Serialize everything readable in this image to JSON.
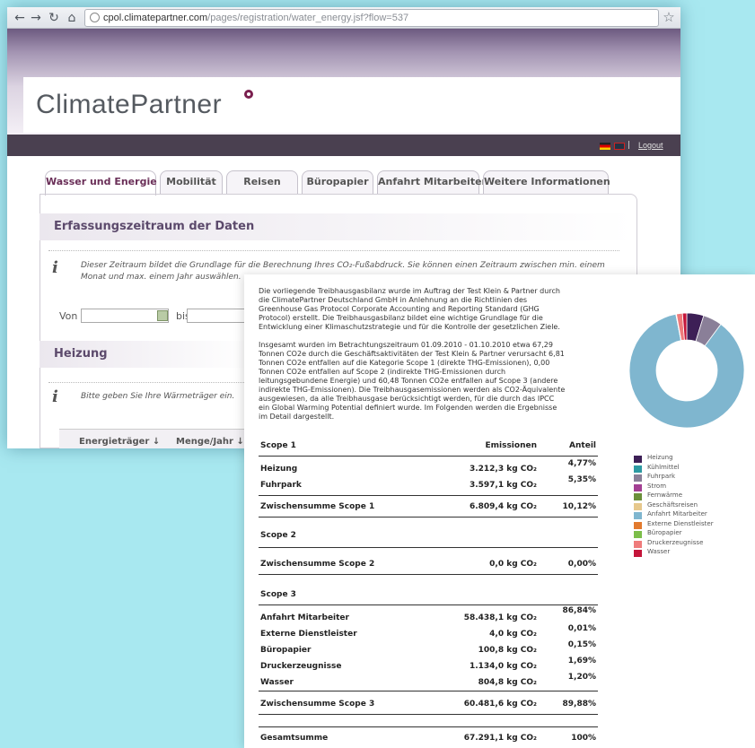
{
  "browser": {
    "url_host": "cpol.climatepartner.com",
    "url_path": "/pages/registration/water_energy.jsf?flow=537",
    "back_icon": "arrow-left-icon",
    "forward_icon": "arrow-right-icon",
    "reload_icon": "reload-icon",
    "home_icon": "home-icon",
    "bookmark_icon": "star-icon"
  },
  "header": {
    "logo_text": "ClimatePartner",
    "logout_label": "Logout",
    "separator": "|",
    "brand_color": "#6b2d5c"
  },
  "tabs": [
    {
      "label": "Wasser und Energie",
      "active": true
    },
    {
      "label": "Mobilität",
      "active": false
    },
    {
      "label": "Reisen",
      "active": false
    },
    {
      "label": "Büropapier",
      "active": false
    },
    {
      "label": "Anfahrt Mitarbeiter",
      "active": false
    },
    {
      "label": "Weitere Informationen",
      "active": false
    }
  ],
  "period": {
    "title": "Erfassungszeitraum der Daten",
    "info_line1": "Dieser Zeitraum bildet die Grundlage für die Berechnung Ihres CO₂-Fußabdruck. Sie können einen Zeitraum zwischen min. einem",
    "info_line2": "Monat und max. einem Jahr auswählen.",
    "from_label": "Von",
    "to_label": "bis"
  },
  "heating": {
    "title": "Heizung",
    "info": "Bitte geben Sie Ihre Wärmeträger ein.",
    "col_energy": "Energieträger ↓",
    "col_amount": "Menge/Jahr ↓"
  },
  "report": {
    "para1": [
      "Die vorliegende Treibhausgasbilanz wurde im Auftrag der Test Klein & Partner durch",
      "die ClimatePartner Deutschland GmbH in Anlehnung an die Richtlinien des",
      "Greenhouse Gas Protocol Corporate Accounting and Reporting Standard (GHG",
      "Protocol) erstellt. Die Treibhausgasbilanz bildet eine wichtige Grundlage für die",
      "Entwicklung einer Klimaschutzstrategie und für die Kontrolle der gesetzlichen Ziele."
    ],
    "para2": [
      "Insgesamt wurden  im Betrachtungszeitraum  01.09.2010 - 01.10.2010 etwa 67,29",
      "Tonnen CO2e durch die Geschäftsaktivitäten der Test Klein & Partner verursacht 6,81",
      "Tonnen CO2e entfallen auf die Kategorie Scope 1 (direkte THG-Emissionen), 0,00",
      "Tonnen CO2e entfallen auf Scope 2 (indirekte THG-Emissionen durch",
      "leitungsgebundene Energie) und 60,48 Tonnen CO2e entfallen auf Scope 3 (andere",
      "indirekte THG-Emissionen). Die Treibhausgasemissionen werden als CO2-Äquivalente",
      "ausgewiesen, da alle Treibhausgase berücksichtigt werden, für die durch das IPCC",
      "ein Global Warming Potential definiert wurde. Im Folgenden werden die Ergebnisse",
      "im Detail dargestellt."
    ],
    "col_emissions": "Emissionen",
    "col_share": "Anteil",
    "scope1_title": "Scope 1",
    "scope1_rows": [
      {
        "label": "Heizung",
        "value": "3.212,3 kg CO₂",
        "share": "4,77%"
      },
      {
        "label": "Fuhrpark",
        "value": "3.597,1 kg CO₂",
        "share": "5,35%"
      }
    ],
    "scope1_subtotal": {
      "label": "Zwischensumme Scope 1",
      "value": "6.809,4 kg CO₂",
      "share": "10,12%"
    },
    "scope2_title": "Scope 2",
    "scope2_subtotal": {
      "label": "Zwischensumme Scope 2",
      "value": "0,0 kg CO₂",
      "share": "0,00%"
    },
    "scope3_title": "Scope 3",
    "scope3_rows": [
      {
        "label": "Anfahrt Mitarbeiter",
        "value": "58.438,1 kg CO₂",
        "share": "86,84%"
      },
      {
        "label": "Externe Dienstleister",
        "value": "4,0 kg CO₂",
        "share": "0,01%"
      },
      {
        "label": "Büropapier",
        "value": "100,8 kg CO₂",
        "share": "0,15%"
      },
      {
        "label": "Druckerzeugnisse",
        "value": "1.134,0 kg CO₂",
        "share": "1,69%"
      },
      {
        "label": "Wasser",
        "value": "804,8 kg CO₂",
        "share": "1,20%"
      }
    ],
    "scope3_subtotal": {
      "label": "Zwischensumme Scope 3",
      "value": "60.481,6 kg CO₂",
      "share": "89,88%"
    },
    "total": {
      "label": "Gesamtsumme",
      "value": "67.291,1 kg CO₂",
      "share": "100%"
    }
  },
  "chart_data": {
    "type": "pie",
    "style": "donut",
    "categories": [
      "Heizung",
      "Kühlmittel",
      "Fuhrpark",
      "Strom",
      "Fernwärme",
      "Geschäftsreisen",
      "Anfahrt Mitarbeiter",
      "Externe Dienstleister",
      "Büropapier",
      "Druckerzeugnisse",
      "Wasser"
    ],
    "values": [
      4.77,
      0,
      5.35,
      0,
      0,
      0,
      86.84,
      0.01,
      0.15,
      1.69,
      1.2
    ],
    "colors": [
      "#3d1f56",
      "#2e9aa3",
      "#8a7f98",
      "#a33f93",
      "#6b8f3a",
      "#e6c88c",
      "#7fb6cf",
      "#e27a2e",
      "#7cbe4a",
      "#ef7b7b",
      "#c4153a"
    ],
    "legend_position": "below"
  }
}
